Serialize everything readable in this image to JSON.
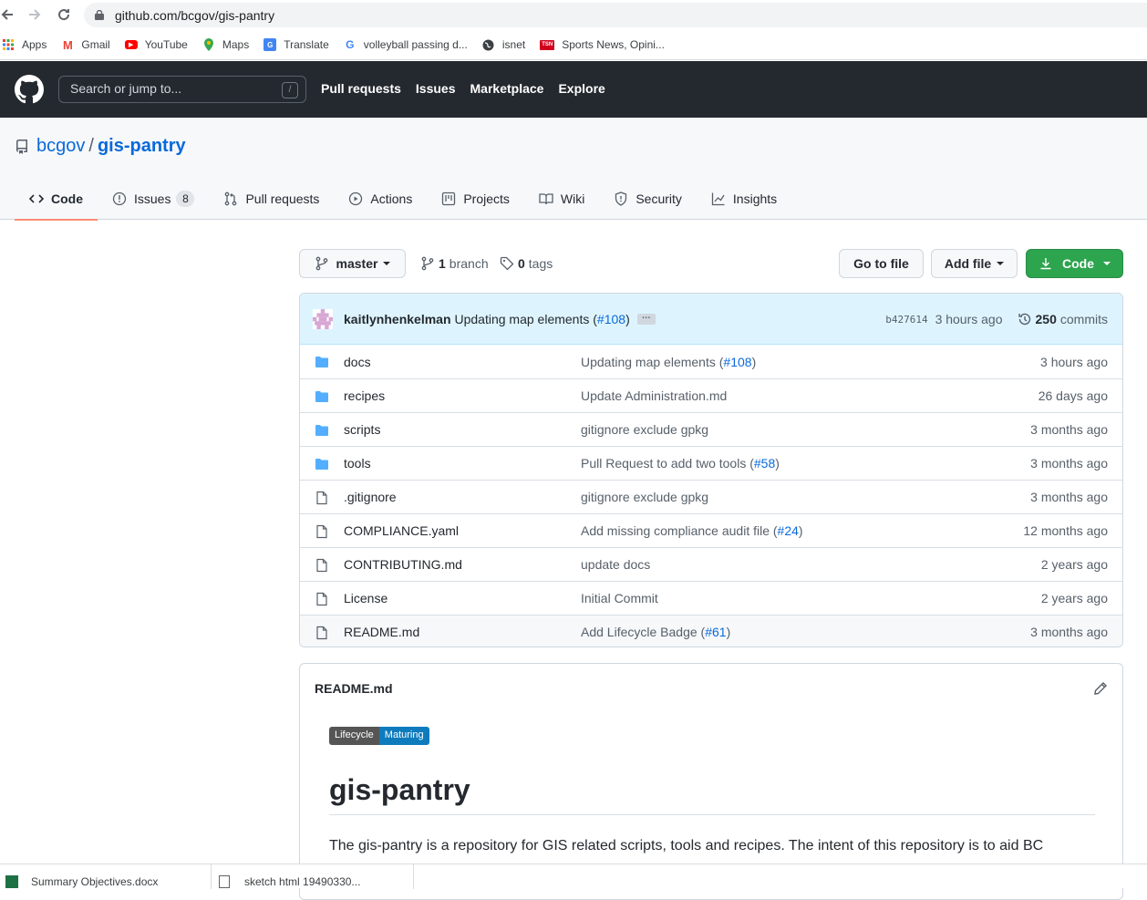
{
  "browser": {
    "url": "github.com/bcgov/gis-pantry",
    "bookmarks": [
      "Apps",
      "Gmail",
      "YouTube",
      "Maps",
      "Translate",
      "volleyball passing d...",
      "isnet",
      "Sports News, Opini..."
    ],
    "downloads": [
      "Summary Objectives.docx",
      "sketch html 19490330..."
    ]
  },
  "github": {
    "search_placeholder": "Search or jump to...",
    "search_hotkey": "/",
    "nav": [
      "Pull requests",
      "Issues",
      "Marketplace",
      "Explore"
    ]
  },
  "repo": {
    "owner": "bcgov",
    "separator": "/",
    "name": "gis-pantry",
    "tabs": [
      {
        "label": "Code",
        "icon": "code-icon"
      },
      {
        "label": "Issues",
        "icon": "issue-icon",
        "count": "8"
      },
      {
        "label": "Pull requests",
        "icon": "pull-request-icon"
      },
      {
        "label": "Actions",
        "icon": "play-icon"
      },
      {
        "label": "Projects",
        "icon": "project-icon"
      },
      {
        "label": "Wiki",
        "icon": "book-icon"
      },
      {
        "label": "Security",
        "icon": "shield-icon"
      },
      {
        "label": "Insights",
        "icon": "graph-icon"
      }
    ]
  },
  "toolbar": {
    "branch": "master",
    "branch_count": "1",
    "branch_label": "branch",
    "tag_count": "0",
    "tag_label": "tags",
    "go_to_file": "Go to file",
    "add_file": "Add file",
    "code": "Code"
  },
  "commit": {
    "author": "kaitlynhenkelman",
    "message": "Updating map elements (",
    "pr": "#108",
    "message_end": ")",
    "ellipsis": "…",
    "sha": "b427614",
    "age": "3 hours ago",
    "commit_count": "250",
    "commit_label": "commits"
  },
  "files": [
    {
      "type": "dir",
      "name": "docs",
      "msg": "Updating map elements (",
      "pr": "#108",
      "msg_end": ")",
      "age": "3 hours ago"
    },
    {
      "type": "dir",
      "name": "recipes",
      "msg": "Update Administration.md",
      "pr": "",
      "msg_end": "",
      "age": "26 days ago"
    },
    {
      "type": "dir",
      "name": "scripts",
      "msg": "gitignore exclude gpkg",
      "pr": "",
      "msg_end": "",
      "age": "3 months ago"
    },
    {
      "type": "dir",
      "name": "tools",
      "msg": "Pull Request to add two tools (",
      "pr": "#58",
      "msg_end": ")",
      "age": "3 months ago"
    },
    {
      "type": "file",
      "name": ".gitignore",
      "msg": "gitignore exclude gpkg",
      "pr": "",
      "msg_end": "",
      "age": "3 months ago"
    },
    {
      "type": "file",
      "name": "COMPLIANCE.yaml",
      "msg": "Add missing compliance audit file (",
      "pr": "#24",
      "msg_end": ")",
      "age": "12 months ago"
    },
    {
      "type": "file",
      "name": "CONTRIBUTING.md",
      "msg": "update docs",
      "pr": "",
      "msg_end": "",
      "age": "2 years ago"
    },
    {
      "type": "file",
      "name": "License",
      "msg": "Initial Commit",
      "pr": "",
      "msg_end": "",
      "age": "2 years ago"
    },
    {
      "type": "file",
      "name": "README.md",
      "msg": "Add Lifecycle Badge (",
      "pr": "#61",
      "msg_end": ")",
      "age": "3 months ago"
    }
  ],
  "readme": {
    "filename": "README.md",
    "badge_left": "Lifecycle",
    "badge_right": "Maturing",
    "heading": "gis-pantry",
    "intro": "The gis-pantry is a repository for GIS related scripts, tools and recipes. The intent of this repository is to aid BC"
  },
  "colors": {
    "header_bg": "#24292f",
    "accent": "#0969da",
    "green_button": "#2da44e",
    "folder": "#54aeff",
    "tab_underline": "#fd8c73"
  }
}
